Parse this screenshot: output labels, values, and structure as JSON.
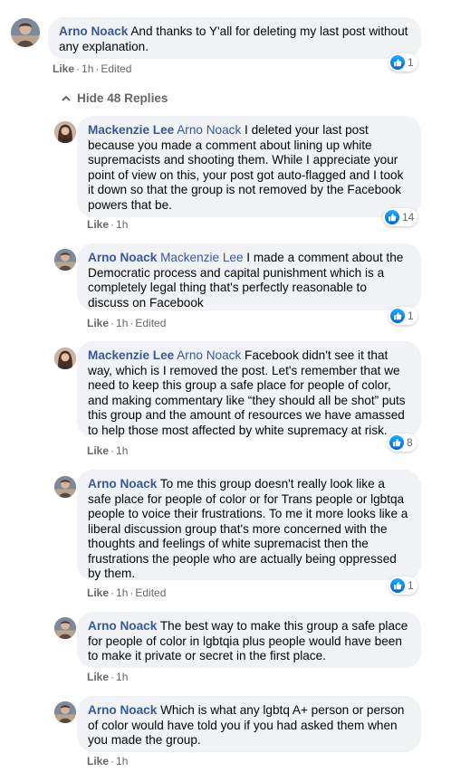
{
  "top_comment": {
    "author": "Arno Noack",
    "text": " And thanks to Y'all for deleting my last post without any explanation.",
    "like": "Like",
    "time": "1h",
    "edited": "Edited",
    "reactions": "1"
  },
  "hide_replies_label": "Hide 48 Replies",
  "replies": [
    {
      "author": "Mackenzie Lee",
      "mention": "Arno Noack",
      "text": " I deleted your last post because you made a comment about lining up white supremacists and shooting them. While I appreciate your point of view on this, your post got auto-flagged and I took it down so that the group is not removed by the Facebook powers that be.",
      "like": "Like",
      "time": "1h",
      "edited": "",
      "reactions": "14"
    },
    {
      "author": "Arno Noack",
      "mention": "Mackenzie Lee",
      "text": " I made a comment about the Democratic process and capital punishment which is a completely legal thing that's perfectly reasonable to discuss on Facebook",
      "like": "Like",
      "time": "1h",
      "edited": "Edited",
      "reactions": "1"
    },
    {
      "author": "Mackenzie Lee",
      "mention": "Arno Noack",
      "text": " Facebook didn't see it that way, which is I removed the post. Let's remember that we need to keep this group a safe place for people of color, and making commentary like “they should all be shot” puts this group and the amount of resources we have amassed to help those most affected by white supremacy at risk.",
      "like": "Like",
      "time": "1h",
      "edited": "",
      "reactions": "8"
    },
    {
      "author": "Arno Noack",
      "mention": "",
      "text": " To me this group doesn't really look like a safe place for people of color or for Trans people or lgbtqa people to voice their frustrations. To me it more looks like a liberal discussion group that's more concerned with the thoughts and feelings of white supremacist then the frustrations the people who are actually being oppressed by them.",
      "like": "Like",
      "time": "1h",
      "edited": "Edited",
      "reactions": "1"
    },
    {
      "author": "Arno Noack",
      "mention": "",
      "text": " The best way to make this group a safe place for people of color in lgbtqia plus people would have been to make it private or secret in the first place.",
      "like": "Like",
      "time": "1h",
      "edited": "",
      "reactions": ""
    },
    {
      "author": "Arno Noack",
      "mention": "",
      "text": " Which is what any lgbtq A+ person or person of color would have told you if you had asked them when you made the group.",
      "like": "Like",
      "time": "1h",
      "edited": "",
      "reactions": ""
    }
  ],
  "colors": {
    "bubble": "#f0f2f5",
    "author": "#385898",
    "meta": "#65676b",
    "like_blue": "#1877f2"
  },
  "icons": [
    "avatar-arno",
    "avatar-mackenzie",
    "like-icon",
    "chevron-up-icon"
  ]
}
